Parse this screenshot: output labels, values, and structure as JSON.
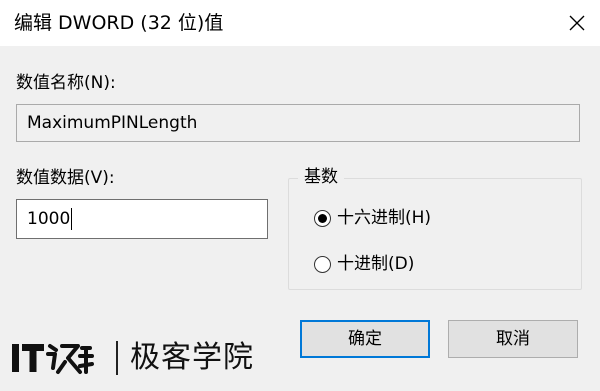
{
  "dialog": {
    "title": "编辑 DWORD (32 位)值"
  },
  "value_name": {
    "label": "数值名称(N):",
    "value": "MaximumPINLength"
  },
  "value_data": {
    "label": "数值数据(V):",
    "value": "1000"
  },
  "base": {
    "legend": "基数",
    "options": [
      {
        "label": "十六进制(H)",
        "selected": true
      },
      {
        "label": "十进制(D)",
        "selected": false
      }
    ]
  },
  "buttons": {
    "ok": "确定",
    "cancel": "取消"
  },
  "watermark": {
    "logo_text": "IT之家",
    "text": "极客学院"
  },
  "colors": {
    "dialog_bg": "#f0f0f0",
    "titlebar_bg": "#ffffff",
    "default_button_border": "#0078d7"
  },
  "icons": {
    "close": "close-icon",
    "radio_selected": "radio-selected-icon",
    "radio_unselected": "radio-unselected-icon"
  }
}
